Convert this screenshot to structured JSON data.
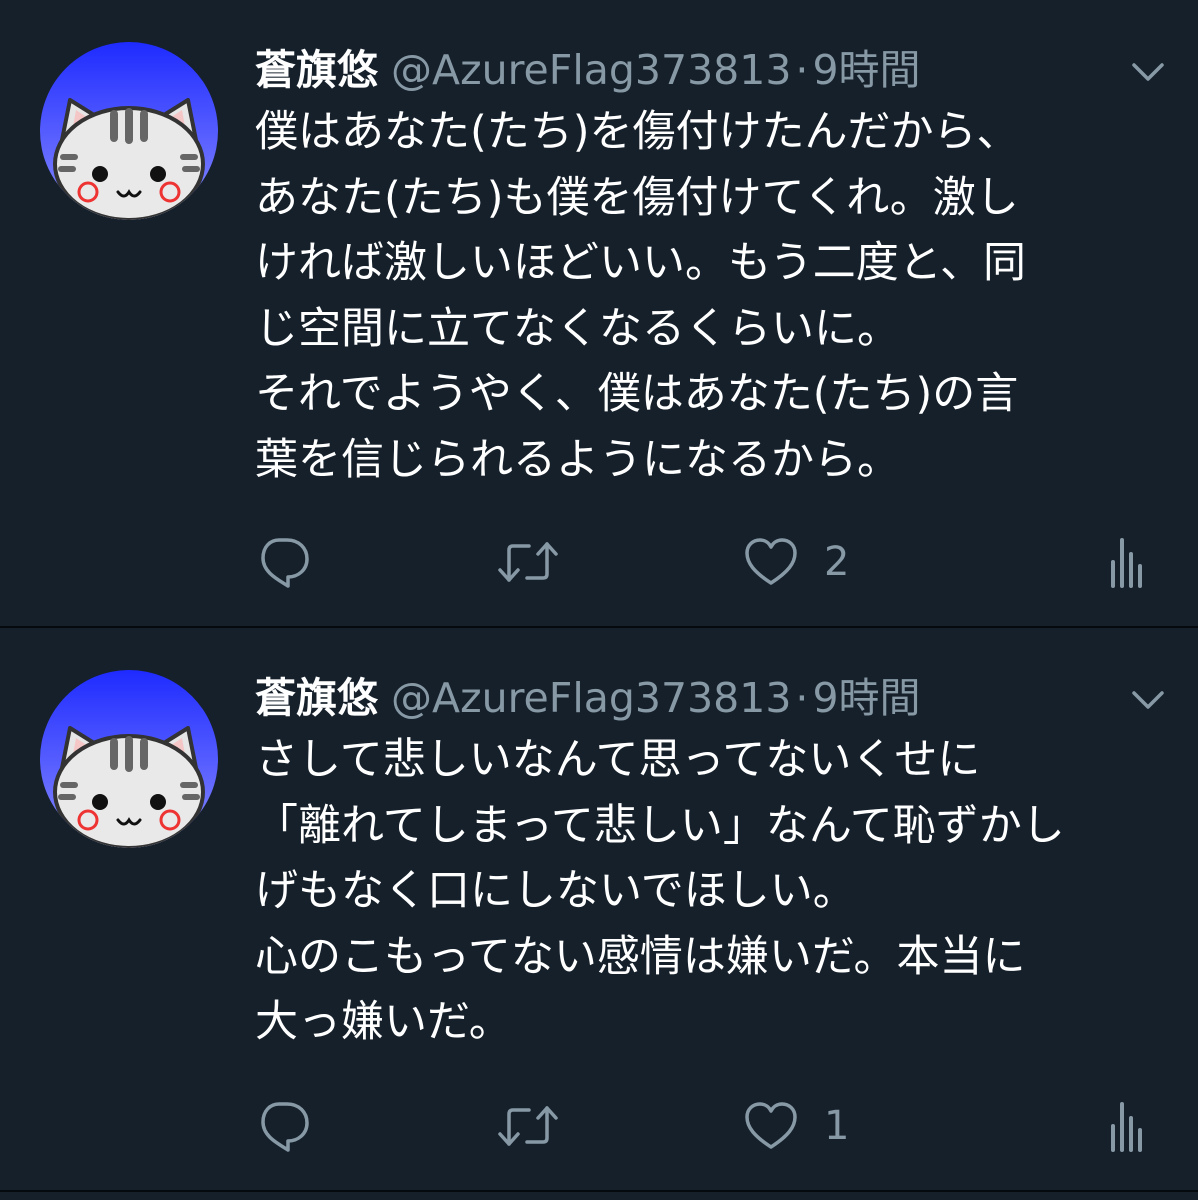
{
  "colors": {
    "background": "#15202b",
    "text_primary": "#ffffff",
    "text_secondary": "#8899a6",
    "divider": "#050a0f",
    "avatar_blue_top": "#1e2bff",
    "avatar_blue_bottom": "#8a8cff"
  },
  "tweets": [
    {
      "author": {
        "display_name": "蒼旗悠",
        "handle": "@AzureFlag373813",
        "separator": "·",
        "time": "9時間"
      },
      "text": "僕はあなた(たち)を傷付けたんだから、\nあなた(たち)も僕を傷付けてくれ。激し\nければ激しいほどいい。もう二度と、同\nじ空間に立てなくなるくらいに。\nそれでようやく、僕はあなた(たち)の言\n葉を信じられるようになるから。",
      "actions": {
        "reply_icon": "reply-icon",
        "retweet_icon": "retweet-icon",
        "like_icon": "heart-icon",
        "like_count": "2",
        "analytics_icon": "analytics-icon"
      }
    },
    {
      "author": {
        "display_name": "蒼旗悠",
        "handle": "@AzureFlag373813",
        "separator": "·",
        "time": "9時間"
      },
      "text": "さして悲しいなんて思ってないくせに\n「離れてしまって悲しい」なんて恥ずかし\nげもなく口にしないでほしい。\n心のこもってない感情は嫌いだ。本当に\n大っ嫌いだ。",
      "actions": {
        "reply_icon": "reply-icon",
        "retweet_icon": "retweet-icon",
        "like_icon": "heart-icon",
        "like_count": "1",
        "analytics_icon": "analytics-icon"
      }
    }
  ]
}
